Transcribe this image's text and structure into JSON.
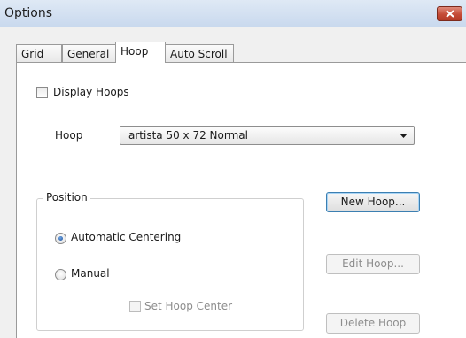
{
  "window": {
    "title": "Options"
  },
  "tabs": [
    {
      "label": "Grid",
      "active": false
    },
    {
      "label": "General",
      "active": false
    },
    {
      "label": "Hoop",
      "active": true
    },
    {
      "label": "Auto Scroll",
      "active": false
    }
  ],
  "hoop_tab": {
    "display_hoops": {
      "label": "Display Hoops",
      "checked": false
    },
    "hoop_field": {
      "label": "Hoop",
      "value": "artista 50 x 72 Normal"
    },
    "position_group": {
      "legend": "Position",
      "automatic_centering": {
        "label": "Automatic Centering",
        "selected": true
      },
      "manual": {
        "label": "Manual",
        "selected": false
      },
      "set_hoop_center": {
        "label": "Set Hoop Center",
        "checked": false,
        "enabled": false
      }
    },
    "buttons": {
      "new_hoop": "New Hoop...",
      "edit_hoop": "Edit Hoop...",
      "delete_hoop": "Delete Hoop"
    }
  },
  "icons": {
    "close": "close-icon",
    "dropdown": "chevron-down-icon"
  },
  "colors": {
    "close_button": "#c44b36",
    "radio_selected": "#1f4f96",
    "default_button_border": "#3c7fb1"
  }
}
